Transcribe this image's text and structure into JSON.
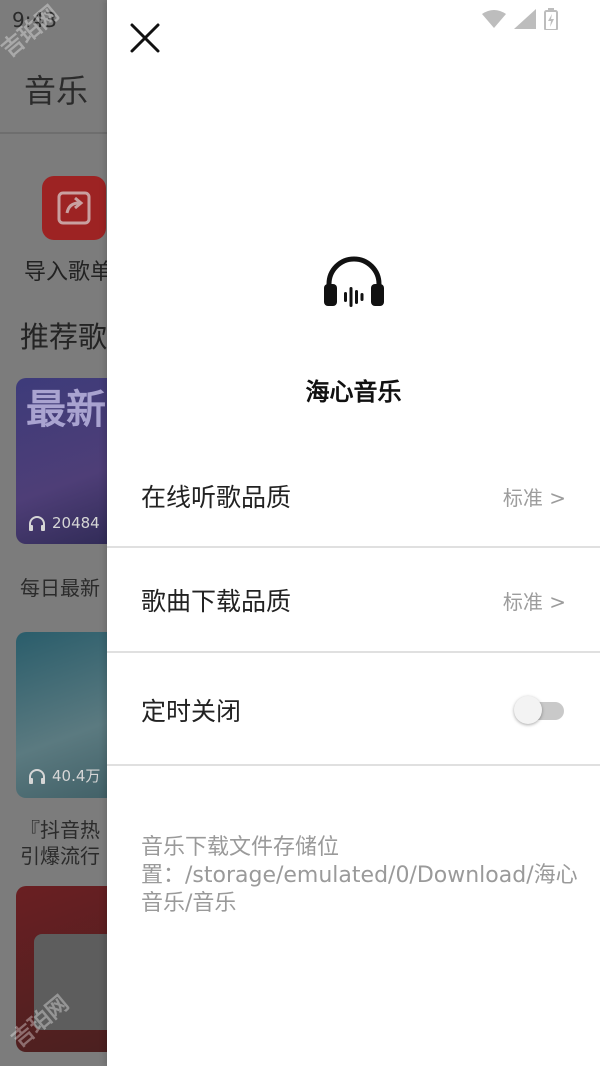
{
  "background": {
    "status_time": "9:43",
    "title": "音乐",
    "import_label": "导入歌单",
    "section_title": "推荐歌单",
    "cards": [
      {
        "big_text": "最新",
        "count": "20484",
        "desc": "每日最新"
      },
      {
        "count": "40.4万",
        "desc_line1": "『抖音热",
        "desc_line2": "引爆流行"
      },
      {}
    ],
    "watermark": "吉珀网"
  },
  "drawer": {
    "brand_name": "海心音乐",
    "settings": [
      {
        "label": "在线听歌品质",
        "value": "标准 >"
      },
      {
        "label": "歌曲下载品质",
        "value": "标准 >"
      },
      {
        "label": "定时关闭",
        "toggle_on": false
      }
    ],
    "storage_text": "音乐下载文件存储位置：/storage/emulated/0/Download/海心音乐/音乐"
  },
  "colors": {
    "drawer_bg": "#ffffff",
    "overlay": "#7c7c7c",
    "import_icon": "#9d2323"
  },
  "icons": [
    "close-icon",
    "headphones-icon",
    "wifi-icon",
    "signal-icon",
    "battery-icon",
    "import-icon",
    "headphone-count-icon"
  ]
}
